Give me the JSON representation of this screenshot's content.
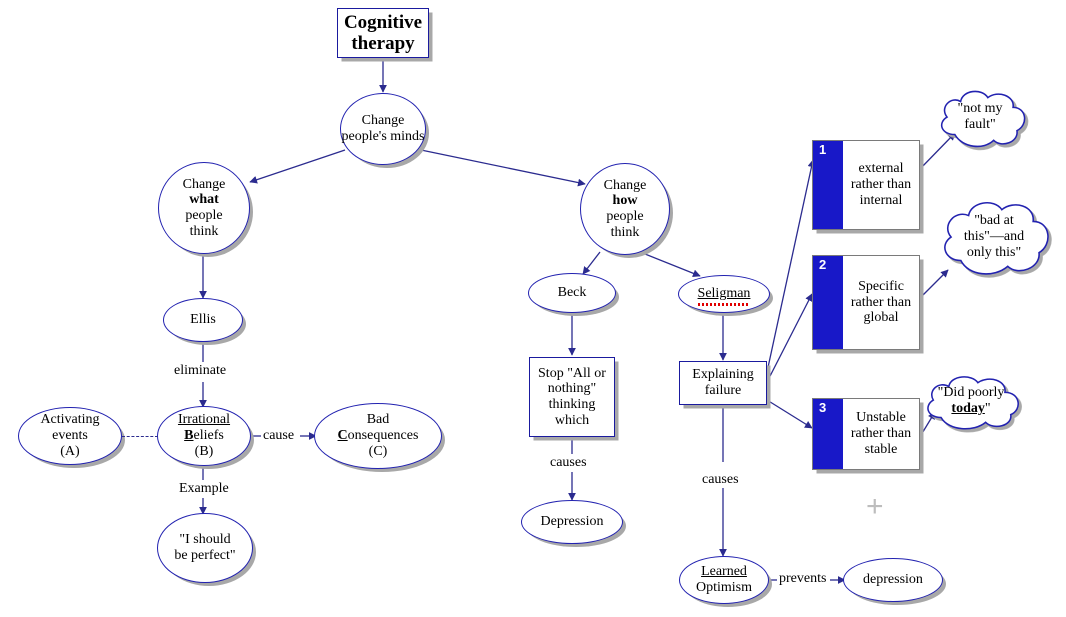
{
  "diagram": {
    "title": "Cognitive therapy concept map",
    "colors": {
      "node_outline": "#2222b0",
      "rect_outline": "#1a1a9e",
      "band_blue": "#1818c8",
      "edge": "#2b2b8f",
      "shadow": "#a8a8a8",
      "spellcheck_red": "#e00000",
      "plus_gray": "#bdbdbd",
      "background": "#ffffff"
    },
    "nodes": {
      "title": "Cognitive therapy",
      "change_minds": "Change people's minds",
      "change_what_line1": "Change",
      "change_what_line2": "what",
      "change_what_line3": "people",
      "change_what_line4": "think",
      "change_how_line1": "Change",
      "change_how_line2": "how",
      "change_how_line3": "people",
      "change_how_line4": "think",
      "ellis": "Ellis",
      "irrational_line1": "Irrational",
      "irrational_line2_b": "B",
      "irrational_line2_rest": "eliefs",
      "irrational_line3": "(B)",
      "activating_line1": "Activating",
      "activating_line2": "events",
      "activating_line3": "(A)",
      "bad_line1": "Bad",
      "bad_line2_c": "C",
      "bad_line2_rest": "onsequences",
      "bad_line3": "(C)",
      "i_should_line1": "\"I should",
      "i_should_line2": "be perfect\"",
      "beck": "Beck",
      "seligman": "Seligman",
      "stop_all_line1": "Stop \"All or",
      "stop_all_line2": "nothing\"",
      "stop_all_line3": "thinking",
      "stop_all_line4": "which",
      "depression_cap": "Depression",
      "explaining_line1": "Explaining",
      "explaining_line2": "failure",
      "learned_line1": "Learned",
      "learned_line2": "Optimism",
      "depression_low": "depression",
      "plus_marker": "+"
    },
    "attribution_boxes": [
      {
        "number": "1",
        "line1": "external",
        "line2": "rather than",
        "line3": "internal"
      },
      {
        "number": "2",
        "line1": "Specific",
        "line2": "rather than",
        "line3": "global"
      },
      {
        "number": "3",
        "line1": "Unstable",
        "line2": "rather than",
        "line3": "stable"
      }
    ],
    "clouds": [
      {
        "line1": "\"not my",
        "line2": "fault\""
      },
      {
        "line1": "\"bad at",
        "line2": "this\"—and",
        "line3": "only this\""
      },
      {
        "line1": "\"Did poorly",
        "line2_bold": "today",
        "line2_tail": "\""
      }
    ],
    "edge_labels": {
      "eliminate": "eliminate",
      "cause": "cause",
      "example": "Example",
      "causes_beck": "causes",
      "causes_seligman": "causes",
      "prevents": "prevents"
    }
  }
}
